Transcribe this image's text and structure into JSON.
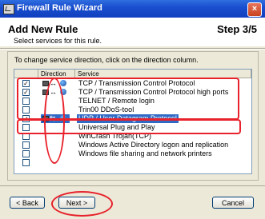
{
  "window": {
    "title": "Firewall Rule Wizard",
    "close_glyph": "×"
  },
  "header": {
    "title": "Add New Rule",
    "step": "Step 3/5",
    "subtitle": "Select services for this rule."
  },
  "instruction": "To change service direction, click on the direction column.",
  "columns": {
    "direction": "Direction",
    "service": "Service"
  },
  "rows": [
    {
      "checked": true,
      "arrow": "↔",
      "service": "TCP / Transmission Control Protocol",
      "selected": false
    },
    {
      "checked": true,
      "arrow": "↔",
      "service": "TCP / Transmission Control Protocol high ports",
      "selected": false
    },
    {
      "checked": false,
      "arrow": "",
      "service": "TELNET / Remote login",
      "selected": false
    },
    {
      "checked": false,
      "arrow": "",
      "service": "Trin00 DDoS-tool",
      "selected": false
    },
    {
      "checked": true,
      "arrow": "⇆",
      "service": "UDP / User Datagram Protocol",
      "selected": true
    },
    {
      "checked": false,
      "arrow": "",
      "service": "Universal Plug and Play",
      "selected": false
    },
    {
      "checked": false,
      "arrow": "",
      "service": "WinCrash Trojan(TCP)",
      "selected": false
    },
    {
      "checked": false,
      "arrow": "",
      "service": "Windows Active Directory logon and replication",
      "selected": false
    },
    {
      "checked": false,
      "arrow": "",
      "service": "Windows file sharing and network printers",
      "selected": false
    },
    {
      "checked": false,
      "arrow": "",
      "service": "",
      "selected": false
    }
  ],
  "buttons": {
    "back": "< Back",
    "next": "Next >",
    "cancel": "Cancel"
  },
  "colors": {
    "annotation": "#e8212b",
    "selection": "#316ac5",
    "titlebar": "#1a4fcf"
  }
}
